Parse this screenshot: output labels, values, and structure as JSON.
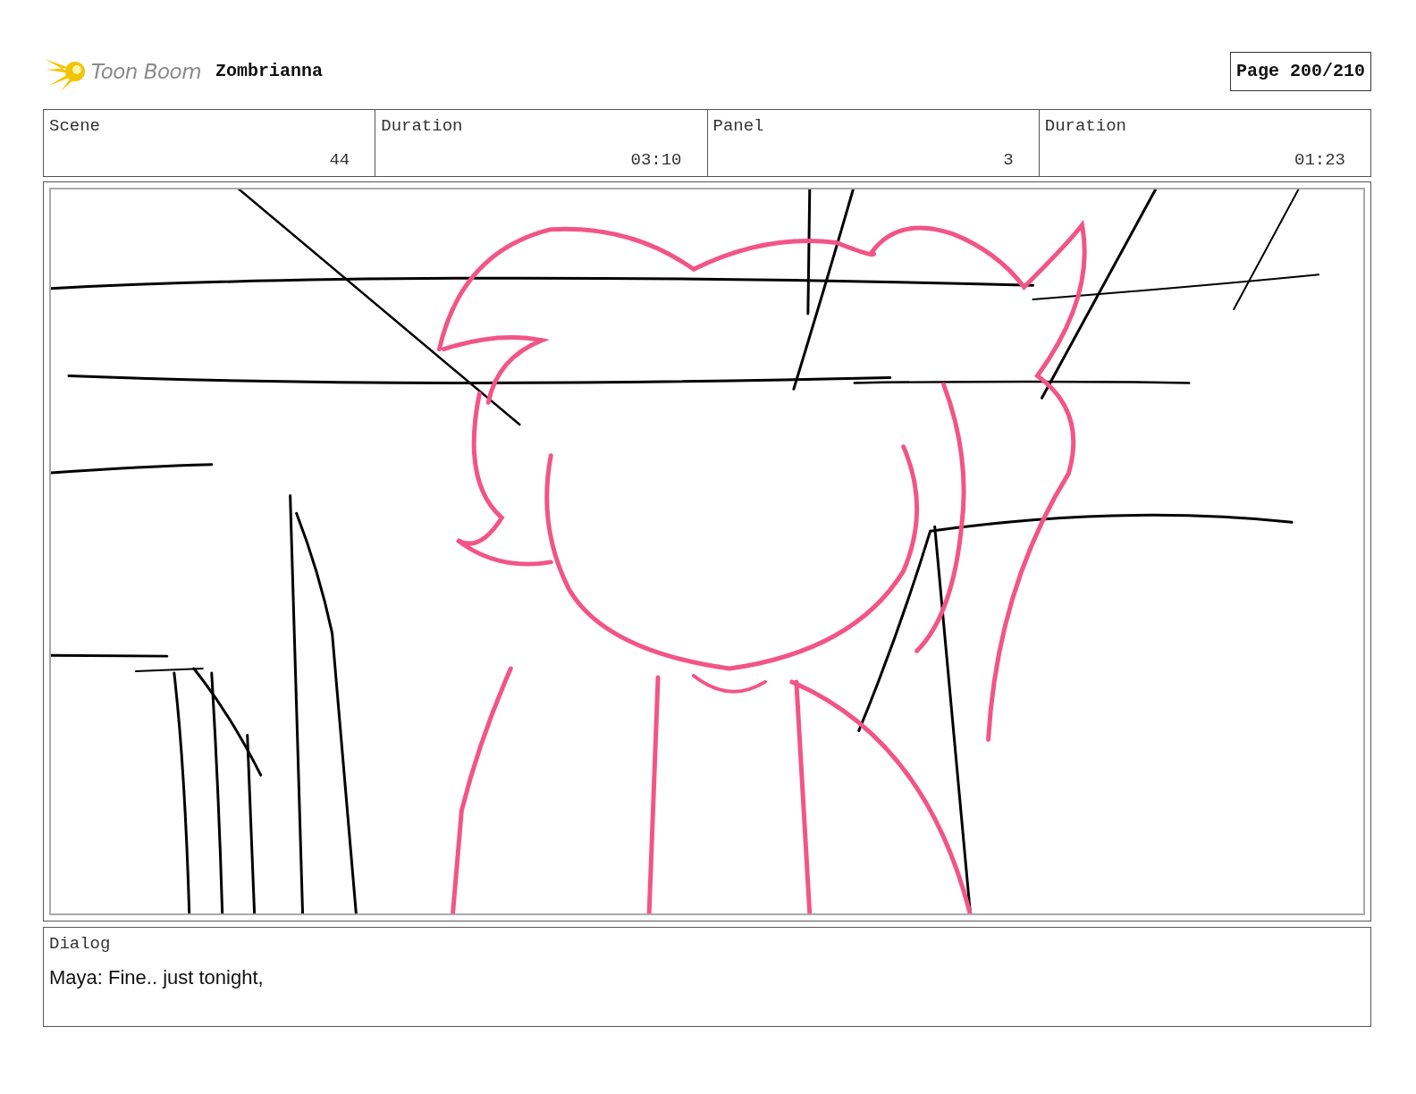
{
  "header": {
    "logo": "Toon Boom",
    "project": "Zombrianna",
    "page": "Page 200/210"
  },
  "info": [
    {
      "label": "Scene",
      "value": "44"
    },
    {
      "label": "Duration",
      "value": "03:10"
    },
    {
      "label": "Panel",
      "value": "3"
    },
    {
      "label": "Duration",
      "value": "01:23"
    }
  ],
  "dialog": {
    "label": "Dialog",
    "text": "Maya: Fine.. just tonight,"
  }
}
